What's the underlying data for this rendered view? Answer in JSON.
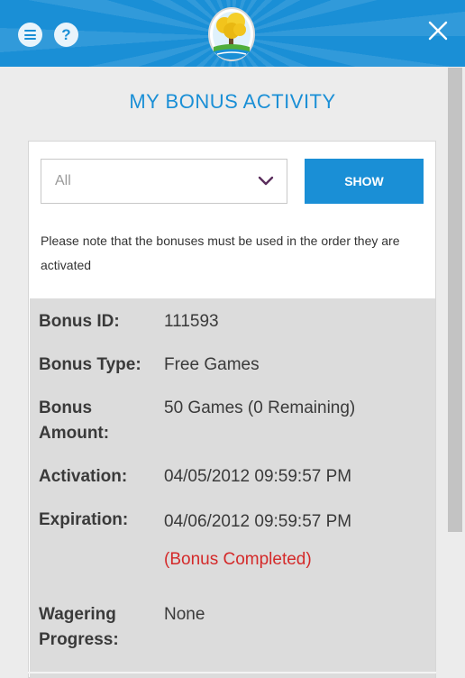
{
  "header": {
    "menu_icon": "hamburger-menu-icon",
    "help_label": "?",
    "logo_icon": "tree-logo-icon",
    "close_icon": "close-icon",
    "colors": {
      "header_bg": "#1a8fd6",
      "accent": "#1a8fd6"
    }
  },
  "page": {
    "title": "MY BONUS ACTIVITY"
  },
  "filter": {
    "selected": "All",
    "chevron_icon": "chevron-down-icon",
    "show_label": "SHOW"
  },
  "note": "Please note that the bonuses must be used in the order they are activated",
  "bonus": {
    "id_label": "Bonus ID:",
    "id_value": "111593",
    "type_label": "Bonus Type:",
    "type_value": "Free Games",
    "amount_label": "Bonus Amount:",
    "amount_value": "50 Games (0 Remaining)",
    "activation_label": "Activation:",
    "activation_value": "04/05/2012 09:59:57 PM",
    "expiration_label": "Expiration:",
    "expiration_value": "04/06/2012 09:59:57 PM",
    "status": "(Bonus Completed)",
    "status_color": "#d42a2a",
    "wagering_label": "Wagering Progress:",
    "wagering_value": "None"
  }
}
